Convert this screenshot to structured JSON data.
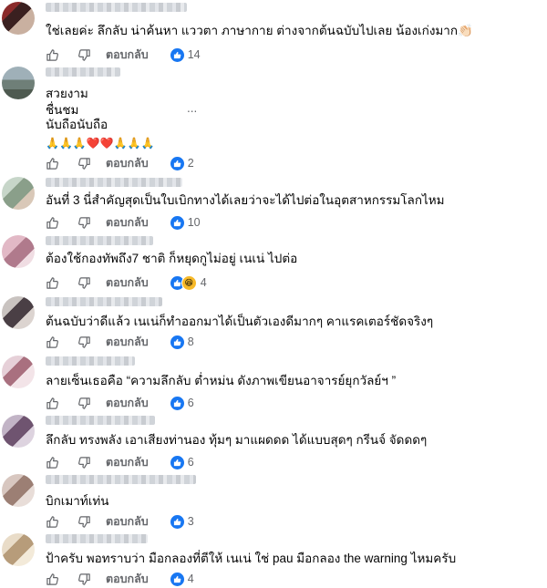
{
  "reply_label": "ตอบกลับ",
  "colors": {
    "link_blue": "#1877f2",
    "secondary_text": "#65676b",
    "haha_yellow": "#f7b928"
  },
  "comments": [
    {
      "lines": [
        "ใช่เลยค่ะ ลึกลับ น่าค้นหา แววตา ภาษากาย ต่างจากต้นฉบับไปเลย น้องเก่งมาก👏🏻"
      ],
      "reactions": [
        "like"
      ],
      "count": "14"
    },
    {
      "lines": [
        "สวยงาม",
        "ชื่นชม",
        "นับถือนับถือ",
        "🙏🙏🙏❤️❤️🙏🙏🙏"
      ],
      "ellipsis": "...",
      "reactions": [
        "like"
      ],
      "count": "2"
    },
    {
      "lines": [
        "อันที่ 3 นี่สำคัญสุดเป็นใบเบิกทางได้เลยว่าจะได้ไปต่อในอุตสาหกรรมโลกไหม"
      ],
      "reactions": [
        "like"
      ],
      "count": "10"
    },
    {
      "lines": [
        "ต้องใช้กองทัพถึง7 ชาติ ก็หยุดกูไม่อยู่ เนเน่ ไปต่อ"
      ],
      "reactions": [
        "like",
        "haha"
      ],
      "count": "4"
    },
    {
      "lines": [
        "ต้นฉบับว่าดีแล้ว เนเน่ก็ทำออกมาได้เป็นตัวเองดีมากๆ คาแรคเตอร์ชัดจริงๆ"
      ],
      "reactions": [
        "like"
      ],
      "count": "8"
    },
    {
      "lines": [
        "ลายเซ็นเธอคือ “ความลึกลับ ต่ำหม่น ดังภาพเขียนอาจารย์ยุกวัลย์ฯ ”"
      ],
      "reactions": [
        "like"
      ],
      "count": "6"
    },
    {
      "lines": [
        "ลึกลับ ทรงพลัง เอาเสียงท่านอง ทุ้มๆ มาแผดดด ได้แบบสุดๆ กรีนจ์ จัดดดๆ"
      ],
      "reactions": [
        "like"
      ],
      "count": "6"
    },
    {
      "lines": [
        "บิกเมาท์เท่น"
      ],
      "reactions": [
        "like"
      ],
      "count": "3"
    },
    {
      "lines": [
        "ป้าครับ พอทราบว่า มือกลองที่ตีให้ เนเน่ ใช่ pau มือกลอง the warning ไหมครับ"
      ],
      "reactions": [
        "like"
      ],
      "count": "4"
    }
  ]
}
